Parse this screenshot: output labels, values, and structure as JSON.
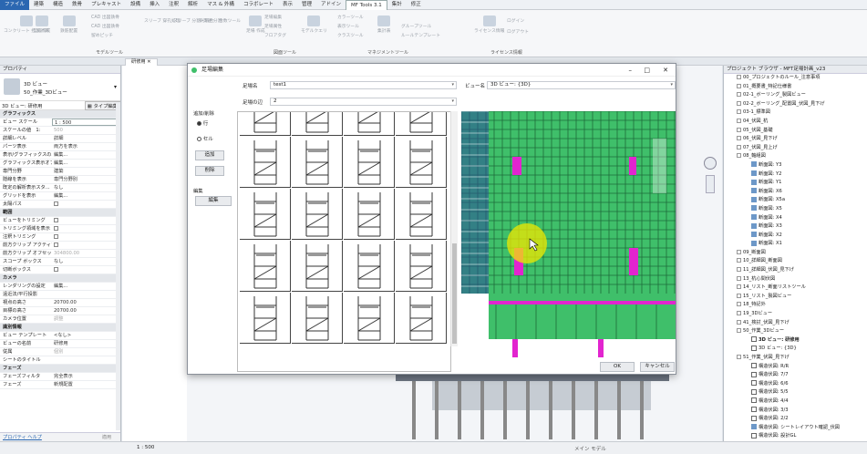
{
  "menubar": [
    "ファイル",
    "建築",
    "構造",
    "鉄骨",
    "プレキャスト",
    "設備",
    "挿入",
    "注釈",
    "解析",
    "マス & 外構",
    "コラボレート",
    "表示",
    "管理",
    "アドイン",
    "MF Tools 3.1",
    "集計",
    "修正"
  ],
  "ribbon": {
    "buttons": [
      "コンクリート\n打設計算",
      "型枠作成",
      "鉄筋配置",
      "CAD 出図鉄骨",
      "CAD 出図鉄骨",
      "留めピッチ",
      "スリーブ\n穿孔処理",
      "スリーブ\n分割・統合",
      "梁貫通\n分割",
      "合数ツール",
      "足場\n作成",
      "足場編集",
      "足場属性",
      "フロアタグ",
      "モデルクエリ",
      "カラーツール",
      "表示ツール",
      "クラスツール",
      "集計表",
      "グループツール",
      "ルールテンプレート",
      "ライセンス情報",
      "ログイン",
      "ログアウト"
    ],
    "groups": [
      "モデルツール",
      "図面ツール",
      "マネジメントツール",
      "ライセンス情報"
    ]
  },
  "properties": {
    "title": "プロパティ",
    "type_name": "3D ビュー",
    "type_sub": "50_作業_3Dビュー",
    "instance_sel": "3D ビュー: 研修用",
    "edit_type": "タイプ編集",
    "rows": [
      {
        "k": "グラフィックス",
        "sec": true
      },
      {
        "k": "ビュー スケール",
        "v": "1 : 500",
        "box": true
      },
      {
        "k": "スケールの値　1:",
        "v": "500",
        "dim": true
      },
      {
        "k": "詳細レベル",
        "v": "詳細"
      },
      {
        "k": "パーツ表示",
        "v": "両方を表示"
      },
      {
        "k": "表示/グラフィックスの...",
        "v": "編集..."
      },
      {
        "k": "グラフィックス表示オプ...",
        "v": "編集..."
      },
      {
        "k": "専門分野",
        "v": "建築"
      },
      {
        "k": "隠線を表示",
        "v": "専門分野別"
      },
      {
        "k": "既定の解析表示スタ...",
        "v": "なし"
      },
      {
        "k": "グリッドを表示",
        "v": "編集..."
      },
      {
        "k": "太陽パス",
        "cb": true
      },
      {
        "k": "範囲",
        "sec": true
      },
      {
        "k": "ビューをトリミング",
        "cb": true
      },
      {
        "k": "トリミング領域を表示",
        "cb": true
      },
      {
        "k": "注釈トリミング",
        "cb": true
      },
      {
        "k": "前方クリップ アクティブ",
        "cb": true
      },
      {
        "k": "前方クリップ オフセット",
        "v": "304800.00",
        "dim": true
      },
      {
        "k": "スコープ ボックス",
        "v": "なし"
      },
      {
        "k": "切断ボックス",
        "cb": true
      },
      {
        "k": "カメラ",
        "sec": true
      },
      {
        "k": "レンダリングの設定",
        "v": "編集..."
      },
      {
        "k": "遠近法/平行投影",
        "v": "",
        "dim": true
      },
      {
        "k": "視点の高さ",
        "v": "20700.00"
      },
      {
        "k": "目標の高さ",
        "v": "20700.00"
      },
      {
        "k": "カメラ位置",
        "v": "調整",
        "dim": true
      },
      {
        "k": "識別情報",
        "sec": true
      },
      {
        "k": "ビュー テンプレート",
        "v": "<なし>"
      },
      {
        "k": "ビューの名前",
        "v": "研修用"
      },
      {
        "k": "従属",
        "v": "個別",
        "dim": true
      },
      {
        "k": "シートのタイトル",
        "v": ""
      },
      {
        "k": "フェーズ",
        "sec": true
      },
      {
        "k": "フェーズフィルタ",
        "v": "完全表示"
      },
      {
        "k": "フェーズ",
        "v": "新規配置"
      }
    ],
    "help": "プロパティ ヘルプ",
    "apply": "適用"
  },
  "canvas_tab": "研修用",
  "browser": {
    "title": "プロジェクト ブラウザ - MFT足場計画_v23",
    "items": [
      {
        "t": "00_プロジェクトのルール_注意事項",
        "l": 1,
        "ex": true
      },
      {
        "t": "01_概要書_特記仕様書",
        "l": 1,
        "ex": true
      },
      {
        "t": "02-1_ボーリング_製図ビュー",
        "l": 1,
        "ex": true
      },
      {
        "t": "02-2_ボーリング_配置図_伏図_見下げ",
        "l": 1,
        "ex": true
      },
      {
        "t": "03-1_標準図",
        "l": 1,
        "ex": true
      },
      {
        "t": "04_伏図_杭",
        "l": 1,
        "ex": true
      },
      {
        "t": "05_伏図_基礎",
        "l": 1,
        "ex": true
      },
      {
        "t": "06_伏図_見下げ",
        "l": 1,
        "ex": true
      },
      {
        "t": "07_伏図_見上げ",
        "l": 1,
        "ex": true
      },
      {
        "t": "08_軸組図",
        "l": 1,
        "ex": true
      },
      {
        "t": "断面図: Y3",
        "l": 2,
        "vi": true
      },
      {
        "t": "断面図: Y2",
        "l": 2,
        "vi": true
      },
      {
        "t": "断面図: Y1",
        "l": 2,
        "vi": true
      },
      {
        "t": "断面図: X6",
        "l": 2,
        "vi": true
      },
      {
        "t": "断面図: X5a",
        "l": 2,
        "vi": true
      },
      {
        "t": "断面図: X5",
        "l": 2,
        "vi": true
      },
      {
        "t": "断面図: X4",
        "l": 2,
        "vi": true
      },
      {
        "t": "断面図: X3",
        "l": 2,
        "vi": true
      },
      {
        "t": "断面図: X2",
        "l": 2,
        "vi": true
      },
      {
        "t": "断面図: X1",
        "l": 2,
        "vi": true
      },
      {
        "t": "09_断面図",
        "l": 1,
        "ex": true
      },
      {
        "t": "10_詳細図_断面図",
        "l": 1,
        "ex": true
      },
      {
        "t": "11_詳細図_伏図_見下げ",
        "l": 1,
        "ex": true
      },
      {
        "t": "13_杭心間伏図",
        "l": 1,
        "ex": true
      },
      {
        "t": "14_リスト_断面リストツール",
        "l": 1,
        "ex": true
      },
      {
        "t": "15_リスト_製図ビュー",
        "l": 1,
        "ex": true
      },
      {
        "t": "18_特記外",
        "l": 1,
        "ex": true
      },
      {
        "t": "19_3Dビュー",
        "l": 1,
        "ex": true
      },
      {
        "t": "41_検討_伏図_見下げ",
        "l": 1,
        "ex": true
      },
      {
        "t": "50_作業_3Dビュー",
        "l": 1,
        "ex": true
      },
      {
        "t": "3D ビュー: 研修用",
        "l": 2,
        "vo": true,
        "bold": true
      },
      {
        "t": "3D ビュー: {3D}",
        "l": 2,
        "vo": true
      },
      {
        "t": "51_作業_伏図_見下げ",
        "l": 1,
        "ex": true
      },
      {
        "t": "構造伏図: R/R",
        "l": 2,
        "vo": true
      },
      {
        "t": "構造伏図: 7/7",
        "l": 2,
        "vo": true
      },
      {
        "t": "構造伏図: 6/6",
        "l": 2,
        "vo": true
      },
      {
        "t": "構造伏図: 5/5",
        "l": 2,
        "vo": true
      },
      {
        "t": "構造伏図: 4/4",
        "l": 2,
        "vo": true
      },
      {
        "t": "構造伏図: 3/3",
        "l": 2,
        "vo": true
      },
      {
        "t": "構造伏図: 2/2",
        "l": 2,
        "vo": true
      },
      {
        "t": "構造伏図: シートレイアウト確認_伏図",
        "l": 2,
        "vi": true
      },
      {
        "t": "構造伏図: 設計GL",
        "l": 2,
        "vo": true
      },
      {
        "t": "53_作業_断面図_軸組図",
        "l": 1,
        "ex": true
      }
    ]
  },
  "dialog": {
    "title": "足場編集",
    "scaffold_name_label": "足場名",
    "scaffold_name_value": "test1",
    "scaffold_side_label": "足場の辺",
    "scaffold_side_value": "2",
    "view_name_label": "ビュー名",
    "view_name_value": "3D ビュー: {3D}",
    "add_delete_label": "追加/削除",
    "radio_row": "行",
    "radio_cell": "セル",
    "add_btn": "追加",
    "delete_btn": "削除",
    "edit_label": "編集",
    "edit_btn": "編集",
    "ok": "OK",
    "cancel": "キャンセル"
  },
  "status": {
    "scale": "1 : 500",
    "model": "メイン モデル"
  },
  "colors": {
    "scaffold_green": "#3fbf6a",
    "magenta": "#e224cf",
    "highlight": "#f0e800",
    "file_blue": "#2b67b1"
  }
}
